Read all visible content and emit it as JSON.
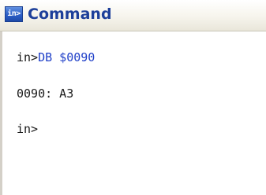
{
  "window": {
    "title": "Command",
    "icon": {
      "name": "command-window-icon",
      "label": "in>"
    }
  },
  "console": {
    "lines": [
      {
        "prompt": "in>",
        "command": "DB $0090"
      },
      {
        "text": "0090: A3"
      },
      {
        "prompt": "in>",
        "command": ""
      }
    ]
  },
  "colors": {
    "title_text": "#1d3f9a",
    "command_text": "#1f3fc8",
    "output_text": "#1a1a1a"
  }
}
